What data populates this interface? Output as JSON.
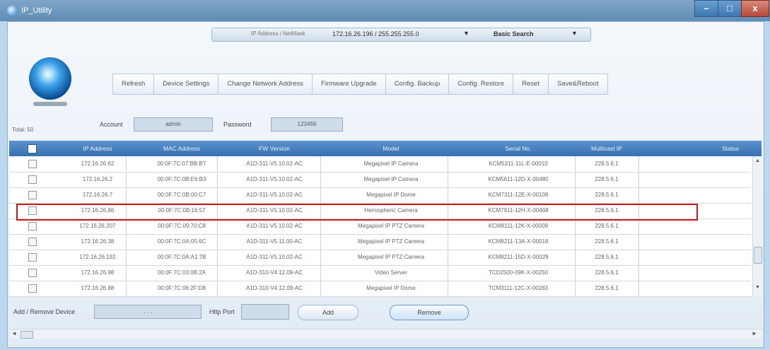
{
  "window": {
    "title": "IP_Utility",
    "controls": {
      "minimize": "–",
      "maximize": "□",
      "close": "x"
    }
  },
  "filter": {
    "label": "IP Address / NetMask",
    "value": "172.16.26.196 / 255.255.255.0",
    "arrow": "▼",
    "search_mode": "Basic Search",
    "search_arrow": "▼"
  },
  "toolbar": {
    "buttons": [
      "Refresh",
      "Device Settings",
      "Change Network Address",
      "Firmware Upgrade",
      "Config. Backup",
      "Config. Restore",
      "Reset",
      "Save&Reboot"
    ]
  },
  "credentials": {
    "total": "Total: 50",
    "account_label": "Account",
    "account_value": "admin",
    "password_label": "Password",
    "password_value": "123456"
  },
  "table": {
    "headers": [
      "",
      "IP Address",
      "MAC Address",
      "FW Version",
      "Model",
      "Serial No.",
      "Multicast IP",
      "Status"
    ],
    "rows": [
      {
        "ip": "172.16.26.62",
        "mac": "00:0F:7C:07:BB:BT",
        "fw": "A1D-311-V5.10.02-AC",
        "model": "Megapixel IP Camera",
        "serial": "KCM5311-11L-E-00010",
        "multicast": "228.5.6.1"
      },
      {
        "ip": "172.16.26.2",
        "mac": "00:0F:7C:0B:E6:B3",
        "fw": "A1D-311-V5.10.02-AC",
        "model": "Megapixel IP Camera",
        "serial": "KCM5611-12D-X-00480",
        "multicast": "228.5.6.1"
      },
      {
        "ip": "172.16.26.7",
        "mac": "00:0F:7C:0B:00:C7",
        "fw": "A1D-311-V5.10.02-AC",
        "model": "Megapixel IP Dome",
        "serial": "KCM7311-12E-X-00108",
        "multicast": "228.5.6.1"
      },
      {
        "ip": "172.16.26.86",
        "mac": "00:0F:7C:0B:16:57",
        "fw": "A1D-311-V5.10.02-AC",
        "model": "Hemispheric Camera",
        "serial": "KCM7911-12H-X-00468",
        "multicast": "228.5.6.1"
      },
      {
        "ip": "172.16.26.207",
        "mac": "00:0F:7C:09:70:C8",
        "fw": "A1D-311-V5.10.02-AC",
        "model": "Megapixel IP PTZ Camera",
        "serial": "KCM8111-12K-X-00009",
        "multicast": "228.5.6.1"
      },
      {
        "ip": "172.16.26.38",
        "mac": "00:0F:7C:0A:05:6C",
        "fw": "A1D-311-V5.11.00-AC",
        "model": "Megapixel IP PTZ Camera",
        "serial": "KCM8211-13A-X-00018",
        "multicast": "228.5.6.1"
      },
      {
        "ip": "172.16.26.192",
        "mac": "00:0F:7C:0A:A1:7B",
        "fw": "A1D-311-V5.10.02-AC",
        "model": "Megapixel IP PTZ Camera",
        "serial": "KCM8211-15D-X-00029",
        "multicast": "228.5.6.1"
      },
      {
        "ip": "172.16.26.98",
        "mac": "00:0F:7C:03:0B:2A",
        "fw": "A1D-310-V4.12.09-AC",
        "model": "Video Server",
        "serial": "TCD2500-09K-X-00250",
        "multicast": "228.5.6.1"
      },
      {
        "ip": "172.16.26.88",
        "mac": "00:0F:7C:06:2F:D8",
        "fw": "A1D-310-V4.12.09-AC",
        "model": "Megapixel IP Dome",
        "serial": "TCM3111-12C-X-00283",
        "multicast": "228.5.6.1"
      }
    ],
    "highlighted_row": 3
  },
  "footer": {
    "add_remove_label": "Add / Remove Device",
    "ip_placeholder": ".   .   .",
    "http_port_label": "Http Port",
    "http_port_value": "",
    "add_button": "Add",
    "remove_button": "Remove"
  },
  "scroll": {
    "up": "▲",
    "down": "▼",
    "left": "◄",
    "right": "►"
  }
}
